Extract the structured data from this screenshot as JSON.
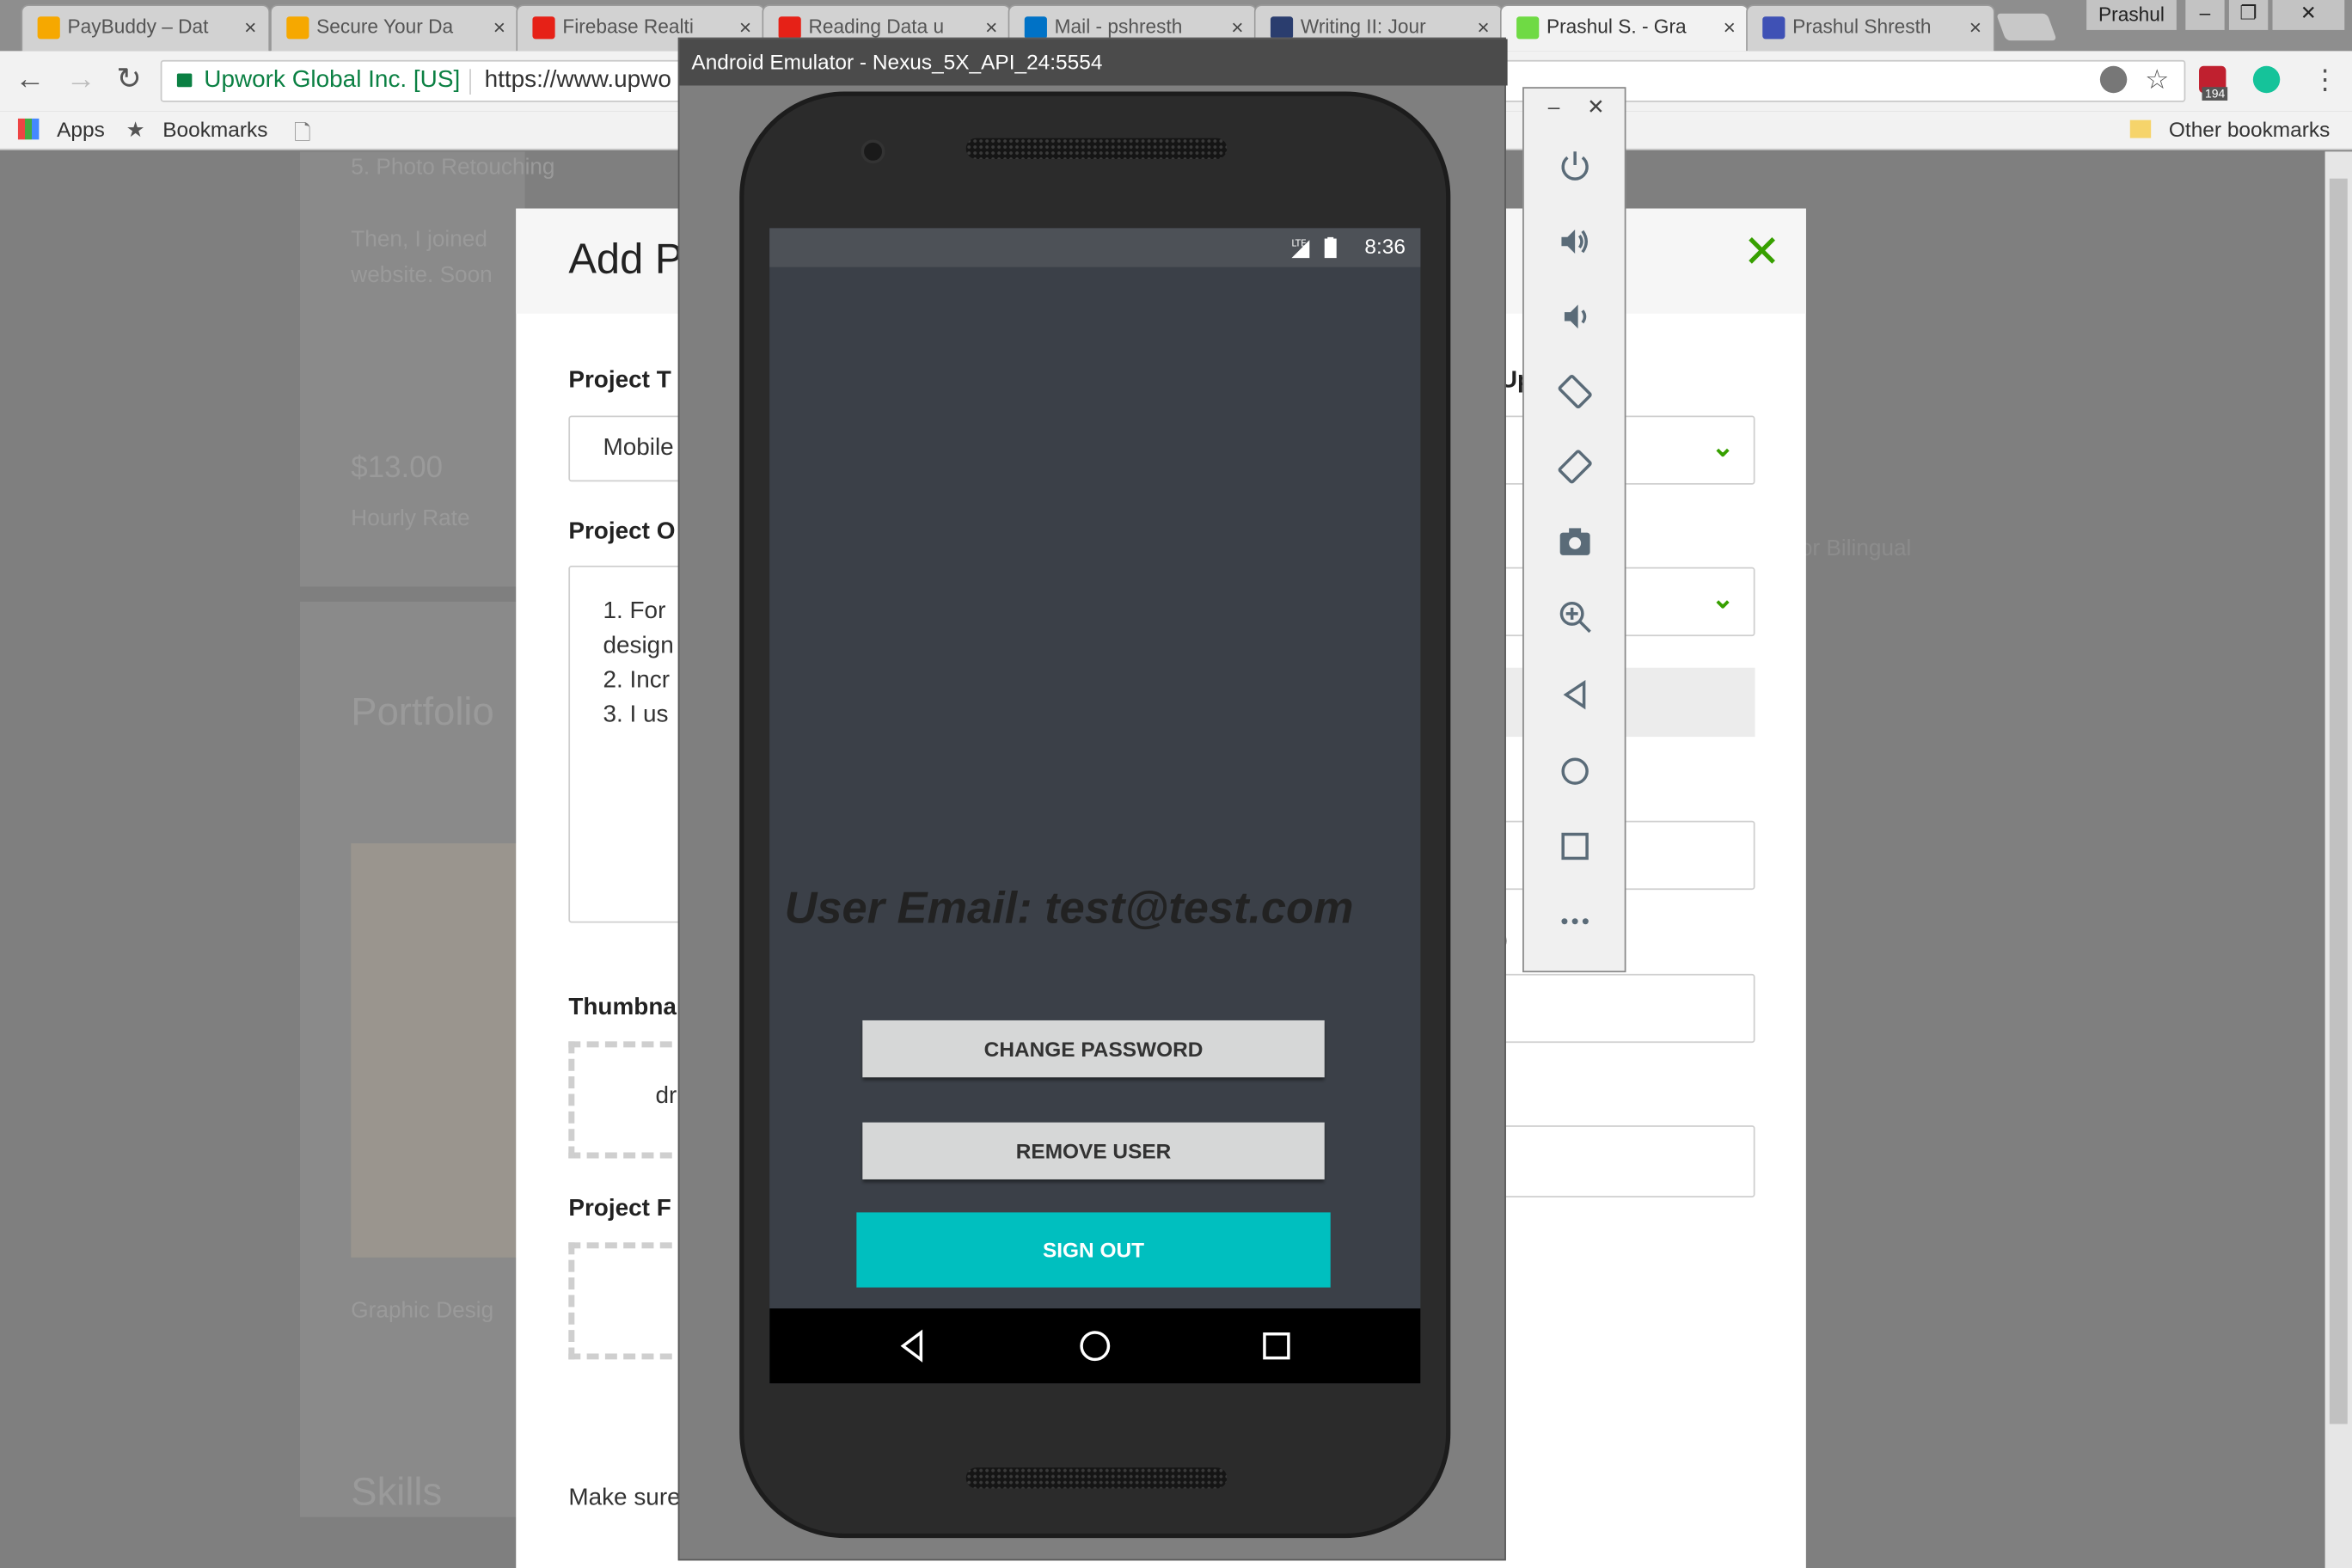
{
  "browser": {
    "tabs": [
      {
        "label": "PayBuddy – Dat",
        "favicon_color": "#f6a800"
      },
      {
        "label": "Secure Your Da",
        "favicon_color": "#f6a800"
      },
      {
        "label": "Firebase Realti",
        "favicon_color": "#e62117"
      },
      {
        "label": "Reading Data u",
        "favicon_color": "#e62117"
      },
      {
        "label": "Mail - pshresth",
        "favicon_color": "#0072c6"
      },
      {
        "label": "Writing II: Jour",
        "favicon_color": "#2a3d6e"
      },
      {
        "label": "Prashul S. - Gra",
        "favicon_color": "#6fda44"
      },
      {
        "label": "Prashul Shresth",
        "favicon_color": "#3f51b5"
      }
    ],
    "user": "Prashul",
    "address": {
      "secure_label": "Upwork Global Inc. [US]",
      "url": "https://www.upwo"
    },
    "ext_badge": "194",
    "bookmarks": {
      "apps": "Apps",
      "bookmarks": "Bookmarks",
      "other": "Other bookmarks"
    }
  },
  "background_page": {
    "photo_retouching": "5. Photo Retouching",
    "joined_text_1": "Then, I joined",
    "joined_text_2": "website. Soon",
    "rate_value": "$13.00",
    "rate_label": "Hourly Rate",
    "portfolio_heading": "Portfolio",
    "graphic_design": "Graphic Desig",
    "skills_heading": "Skills",
    "bilingual": "or Bilingual"
  },
  "modal": {
    "title": "Add P",
    "project_title_label": "Project T",
    "project_title_value": "Mobile",
    "project_overview_label": "Project O",
    "overview_lines": [
      "1. For",
      "design",
      "2. Incr",
      "3. I us"
    ],
    "thumbnail_label": "Thumbna",
    "thumbnail_hint": "dr",
    "project_files_label": "Project F",
    "footer_text": "Make sure",
    "right_label": "Up",
    "right_paren": ")"
  },
  "emulator": {
    "window_title": "Android Emulator - Nexus_5X_API_24:5554",
    "status_time": "8:36",
    "user_email_text": "User Email: test@test.com",
    "change_password_label": "CHANGE PASSWORD",
    "remove_user_label": "REMOVE USER",
    "sign_out_label": "SIGN OUT",
    "accent_color": "#00bfbf",
    "side_controls": [
      "power-icon",
      "volume-up-icon",
      "volume-down-icon",
      "rotate-left-icon",
      "rotate-right-icon",
      "camera-icon",
      "zoom-icon",
      "back-icon",
      "home-icon",
      "overview-icon",
      "more-icon"
    ]
  }
}
